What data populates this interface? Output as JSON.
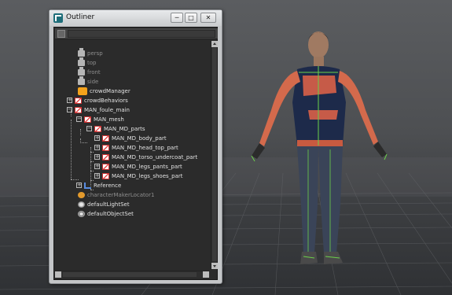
{
  "window": {
    "title": "Outliner",
    "icon": "maya-app-icon",
    "buttons": {
      "minimize": "─",
      "maximize": "□",
      "close": "✕"
    }
  },
  "outliner": {
    "items": [
      {
        "label": "persp",
        "icon": "camera-icon",
        "dim": true
      },
      {
        "label": "top",
        "icon": "camera-icon",
        "dim": true
      },
      {
        "label": "front",
        "icon": "camera-icon",
        "dim": true
      },
      {
        "label": "side",
        "icon": "camera-icon",
        "dim": true
      },
      {
        "label": "crowdManager",
        "icon": "crowd-manager-icon"
      },
      {
        "label": "crowdBehaviors",
        "icon": "set-icon",
        "expander": "+"
      },
      {
        "label": "MAN_foule_main",
        "icon": "set-icon",
        "expander": "−"
      },
      {
        "label": "MAN_mesh",
        "icon": "set-icon",
        "expander": "−"
      },
      {
        "label": "MAN_MD_parts",
        "icon": "set-icon",
        "expander": "−"
      },
      {
        "label": "MAN_MD_body_part",
        "icon": "set-icon",
        "expander": "+"
      },
      {
        "label": "MAN_MD_head_top_part",
        "icon": "set-icon",
        "expander": "+"
      },
      {
        "label": "MAN_MD_torso_undercoat_part",
        "icon": "set-icon",
        "expander": "+"
      },
      {
        "label": "MAN_MD_legs_pants_part",
        "icon": "set-icon",
        "expander": "+"
      },
      {
        "label": "MAN_MD_legs_shoes_part",
        "icon": "set-icon",
        "expander": "+"
      },
      {
        "label": "Reference",
        "icon": "reference-icon",
        "expander": "+"
      },
      {
        "label": "characterMakerLocator1",
        "icon": "locator-icon",
        "dim": true
      },
      {
        "label": "defaultLightSet",
        "icon": "light-set-icon"
      },
      {
        "label": "defaultObjectSet",
        "icon": "object-set-icon"
      }
    ]
  },
  "colors": {
    "viewport_bg": "#4d4f52",
    "outliner_bg": "#2b2b2b",
    "text": "#e2e2e2",
    "dim_text": "#8e8e8e",
    "accent": "#f4a21b"
  },
  "viewport": {
    "character": "3d-character-model",
    "grid": true
  }
}
